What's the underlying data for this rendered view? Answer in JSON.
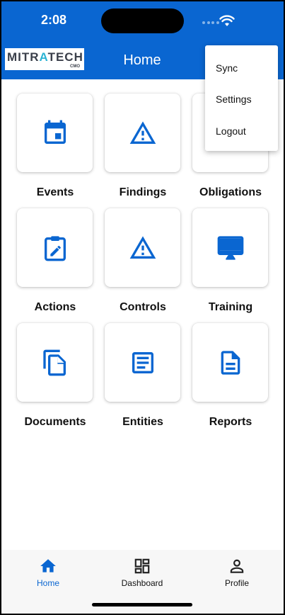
{
  "status_bar": {
    "time": "2:08"
  },
  "app_bar": {
    "logo": {
      "text_main_a": "MITR",
      "text_accent": "A",
      "text_main_b": "TECH",
      "text_sub": "CMO"
    },
    "title": "Home"
  },
  "tiles": [
    {
      "label": "Events",
      "icon": "calendar-icon"
    },
    {
      "label": "Findings",
      "icon": "warning-icon"
    },
    {
      "label": "Obligations",
      "icon": "warning-icon"
    },
    {
      "label": "Actions",
      "icon": "clipboard-edit-icon"
    },
    {
      "label": "Controls",
      "icon": "warning-icon"
    },
    {
      "label": "Training",
      "icon": "monitor-icon"
    },
    {
      "label": "Documents",
      "icon": "copy-file-icon"
    },
    {
      "label": "Entities",
      "icon": "article-icon"
    },
    {
      "label": "Reports",
      "icon": "document-icon"
    }
  ],
  "menu": {
    "items": [
      "Sync",
      "Settings",
      "Logout"
    ]
  },
  "bottom_nav": {
    "items": [
      {
        "label": "Home",
        "icon": "home-icon",
        "active": true
      },
      {
        "label": "Dashboard",
        "icon": "dashboard-icon",
        "active": false
      },
      {
        "label": "Profile",
        "icon": "person-icon",
        "active": false
      }
    ]
  },
  "colors": {
    "primary": "#0a66d1",
    "logo_accent": "#2bb3d4"
  }
}
